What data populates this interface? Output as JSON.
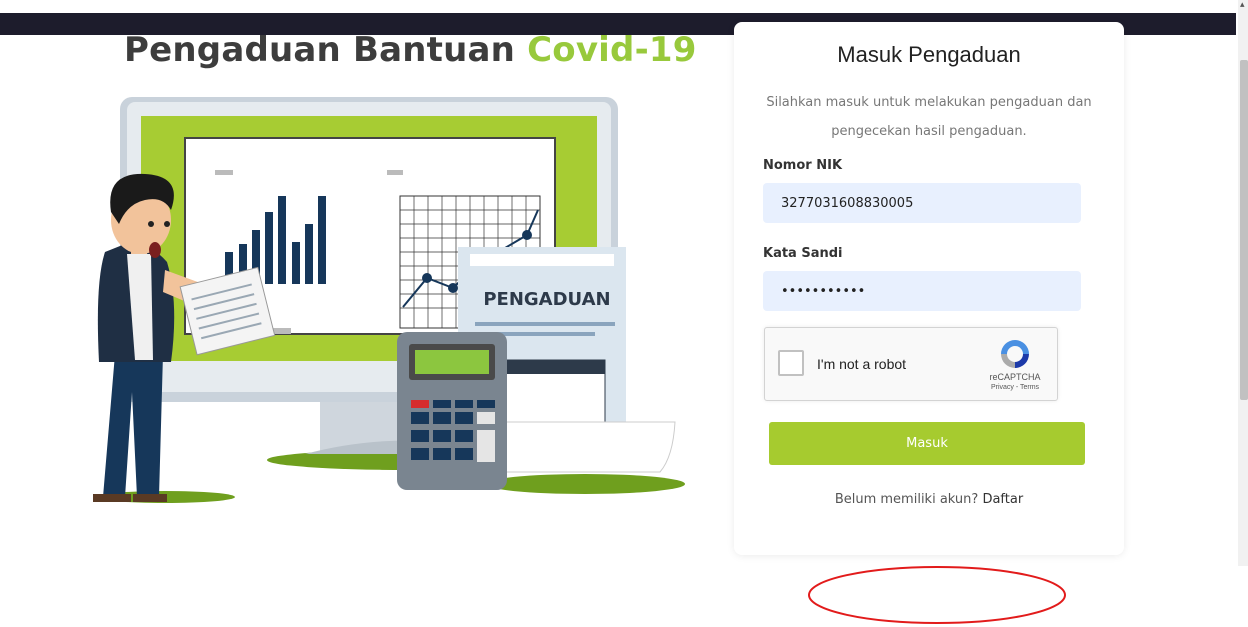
{
  "hero": {
    "title_main": "Pengaduan Bantuan ",
    "title_accent": "Covid-19",
    "sign_text": "PENGADUAN",
    "accent_color": "#98c93c"
  },
  "login": {
    "title": "Masuk Pengaduan",
    "description": "Silahkan masuk untuk melakukan pengaduan dan pengecekan hasil pengaduan.",
    "nik_label": "Nomor NIK",
    "nik_value": "3277031608830005",
    "password_label": "Kata Sandi",
    "password_value": "passwordxyz",
    "captcha_label": "I'm not a robot",
    "captcha_brand": "reCAPTCHA",
    "captcha_links": "Privacy - Terms",
    "submit_label": "Masuk",
    "register_prompt": "Belum memiliki akun? ",
    "register_link": "Daftar",
    "button_color": "#a6cb2f",
    "input_bg": "#e8f0fe"
  },
  "annotation": {
    "color": "#e21b1b",
    "shape": "ellipse-outline"
  }
}
